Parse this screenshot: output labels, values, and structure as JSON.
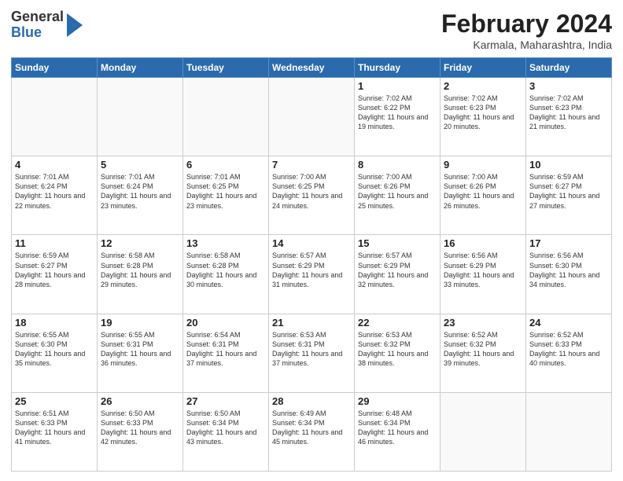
{
  "logo": {
    "general": "General",
    "blue": "Blue"
  },
  "header": {
    "month_year": "February 2024",
    "location": "Karmala, Maharashtra, India"
  },
  "weekdays": [
    "Sunday",
    "Monday",
    "Tuesday",
    "Wednesday",
    "Thursday",
    "Friday",
    "Saturday"
  ],
  "weeks": [
    [
      {
        "day": null
      },
      {
        "day": null
      },
      {
        "day": null
      },
      {
        "day": null
      },
      {
        "day": "1",
        "sunrise": "7:02 AM",
        "sunset": "6:22 PM",
        "daylight": "11 hours and 19 minutes."
      },
      {
        "day": "2",
        "sunrise": "7:02 AM",
        "sunset": "6:23 PM",
        "daylight": "11 hours and 20 minutes."
      },
      {
        "day": "3",
        "sunrise": "7:02 AM",
        "sunset": "6:23 PM",
        "daylight": "11 hours and 21 minutes."
      }
    ],
    [
      {
        "day": "4",
        "sunrise": "7:01 AM",
        "sunset": "6:24 PM",
        "daylight": "11 hours and 22 minutes."
      },
      {
        "day": "5",
        "sunrise": "7:01 AM",
        "sunset": "6:24 PM",
        "daylight": "11 hours and 23 minutes."
      },
      {
        "day": "6",
        "sunrise": "7:01 AM",
        "sunset": "6:25 PM",
        "daylight": "11 hours and 23 minutes."
      },
      {
        "day": "7",
        "sunrise": "7:00 AM",
        "sunset": "6:25 PM",
        "daylight": "11 hours and 24 minutes."
      },
      {
        "day": "8",
        "sunrise": "7:00 AM",
        "sunset": "6:26 PM",
        "daylight": "11 hours and 25 minutes."
      },
      {
        "day": "9",
        "sunrise": "7:00 AM",
        "sunset": "6:26 PM",
        "daylight": "11 hours and 26 minutes."
      },
      {
        "day": "10",
        "sunrise": "6:59 AM",
        "sunset": "6:27 PM",
        "daylight": "11 hours and 27 minutes."
      }
    ],
    [
      {
        "day": "11",
        "sunrise": "6:59 AM",
        "sunset": "6:27 PM",
        "daylight": "11 hours and 28 minutes."
      },
      {
        "day": "12",
        "sunrise": "6:58 AM",
        "sunset": "6:28 PM",
        "daylight": "11 hours and 29 minutes."
      },
      {
        "day": "13",
        "sunrise": "6:58 AM",
        "sunset": "6:28 PM",
        "daylight": "11 hours and 30 minutes."
      },
      {
        "day": "14",
        "sunrise": "6:57 AM",
        "sunset": "6:29 PM",
        "daylight": "11 hours and 31 minutes."
      },
      {
        "day": "15",
        "sunrise": "6:57 AM",
        "sunset": "6:29 PM",
        "daylight": "11 hours and 32 minutes."
      },
      {
        "day": "16",
        "sunrise": "6:56 AM",
        "sunset": "6:29 PM",
        "daylight": "11 hours and 33 minutes."
      },
      {
        "day": "17",
        "sunrise": "6:56 AM",
        "sunset": "6:30 PM",
        "daylight": "11 hours and 34 minutes."
      }
    ],
    [
      {
        "day": "18",
        "sunrise": "6:55 AM",
        "sunset": "6:30 PM",
        "daylight": "11 hours and 35 minutes."
      },
      {
        "day": "19",
        "sunrise": "6:55 AM",
        "sunset": "6:31 PM",
        "daylight": "11 hours and 36 minutes."
      },
      {
        "day": "20",
        "sunrise": "6:54 AM",
        "sunset": "6:31 PM",
        "daylight": "11 hours and 37 minutes."
      },
      {
        "day": "21",
        "sunrise": "6:53 AM",
        "sunset": "6:31 PM",
        "daylight": "11 hours and 37 minutes."
      },
      {
        "day": "22",
        "sunrise": "6:53 AM",
        "sunset": "6:32 PM",
        "daylight": "11 hours and 38 minutes."
      },
      {
        "day": "23",
        "sunrise": "6:52 AM",
        "sunset": "6:32 PM",
        "daylight": "11 hours and 39 minutes."
      },
      {
        "day": "24",
        "sunrise": "6:52 AM",
        "sunset": "6:33 PM",
        "daylight": "11 hours and 40 minutes."
      }
    ],
    [
      {
        "day": "25",
        "sunrise": "6:51 AM",
        "sunset": "6:33 PM",
        "daylight": "11 hours and 41 minutes."
      },
      {
        "day": "26",
        "sunrise": "6:50 AM",
        "sunset": "6:33 PM",
        "daylight": "11 hours and 42 minutes."
      },
      {
        "day": "27",
        "sunrise": "6:50 AM",
        "sunset": "6:34 PM",
        "daylight": "11 hours and 43 minutes."
      },
      {
        "day": "28",
        "sunrise": "6:49 AM",
        "sunset": "6:34 PM",
        "daylight": "11 hours and 45 minutes."
      },
      {
        "day": "29",
        "sunrise": "6:48 AM",
        "sunset": "6:34 PM",
        "daylight": "11 hours and 46 minutes."
      },
      {
        "day": null
      },
      {
        "day": null
      }
    ]
  ]
}
